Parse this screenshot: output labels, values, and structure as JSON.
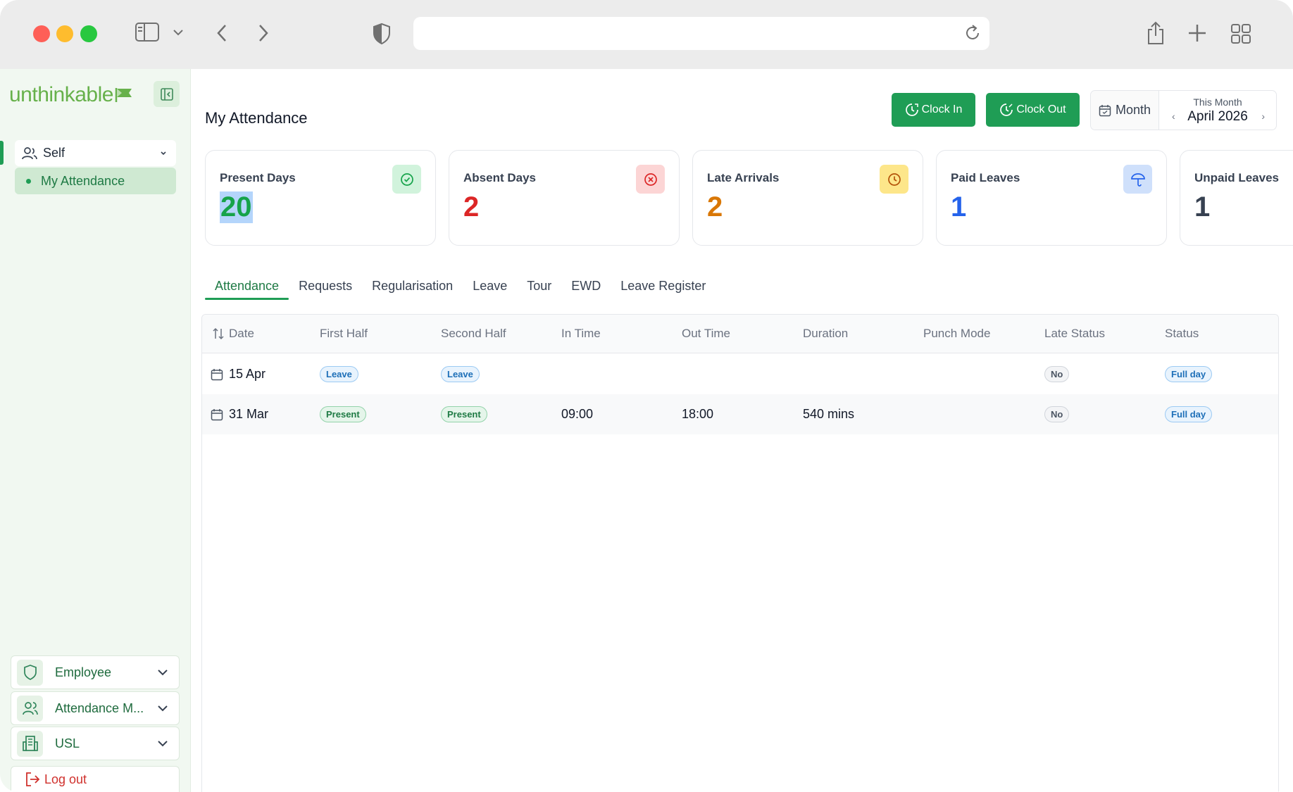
{
  "browser": {
    "url": ""
  },
  "sidebar": {
    "logo_text": "unthinkable",
    "self_label": "Self",
    "active_item": "My Attendance",
    "menus": [
      {
        "label": "Employee",
        "icon": "shield-icon"
      },
      {
        "label": "Attendance M...",
        "icon": "users-icon"
      },
      {
        "label": "USL",
        "icon": "building-icon"
      }
    ],
    "logout_label": "Log out"
  },
  "header": {
    "title": "My Attendance",
    "clock_in_label": "Clock In",
    "clock_out_label": "Clock Out",
    "period_mode": "Month",
    "period_caption": "This Month",
    "period_value": "April 2026",
    "prev_symbol": "‹",
    "next_symbol": "›"
  },
  "cards": [
    {
      "title": "Present Days",
      "value": "20",
      "color": "#16a34a",
      "icon": "check-circle-icon",
      "icon_bg": "#d1f3dc",
      "icon_color": "#16a34a"
    },
    {
      "title": "Absent Days",
      "value": "2",
      "color": "#dc2626",
      "icon": "x-circle-icon",
      "icon_bg": "#fcd5d5",
      "icon_color": "#dc2626"
    },
    {
      "title": "Late Arrivals",
      "value": "2",
      "color": "#d97706",
      "icon": "clock-icon",
      "icon_bg": "#fde68a",
      "icon_color": "#b45309"
    },
    {
      "title": "Paid Leaves",
      "value": "1",
      "color": "#2563eb",
      "icon": "umbrella-icon",
      "icon_bg": "#cfe0fb",
      "icon_color": "#2563eb"
    },
    {
      "title": "Unpaid Leaves",
      "value": "1",
      "color": "#374151",
      "icon": "",
      "icon_bg": "",
      "icon_color": ""
    }
  ],
  "tabs": [
    "Attendance",
    "Requests",
    "Regularisation",
    "Leave",
    "Tour",
    "EWD",
    "Leave Register"
  ],
  "table": {
    "columns": [
      "Date",
      "First Half",
      "Second Half",
      "In Time",
      "Out Time",
      "Duration",
      "Punch Mode",
      "Late Status",
      "Status"
    ],
    "rows": [
      {
        "date": "15 Apr",
        "first_half": "Leave",
        "second_half": "Leave",
        "in_time": "",
        "out_time": "",
        "duration": "",
        "punch_mode": "",
        "late_status": "No",
        "status": "Full day"
      },
      {
        "date": "31 Mar",
        "first_half": "Present",
        "second_half": "Present",
        "in_time": "09:00",
        "out_time": "18:00",
        "duration": "540 mins",
        "punch_mode": "",
        "late_status": "No",
        "status": "Full day"
      }
    ]
  }
}
